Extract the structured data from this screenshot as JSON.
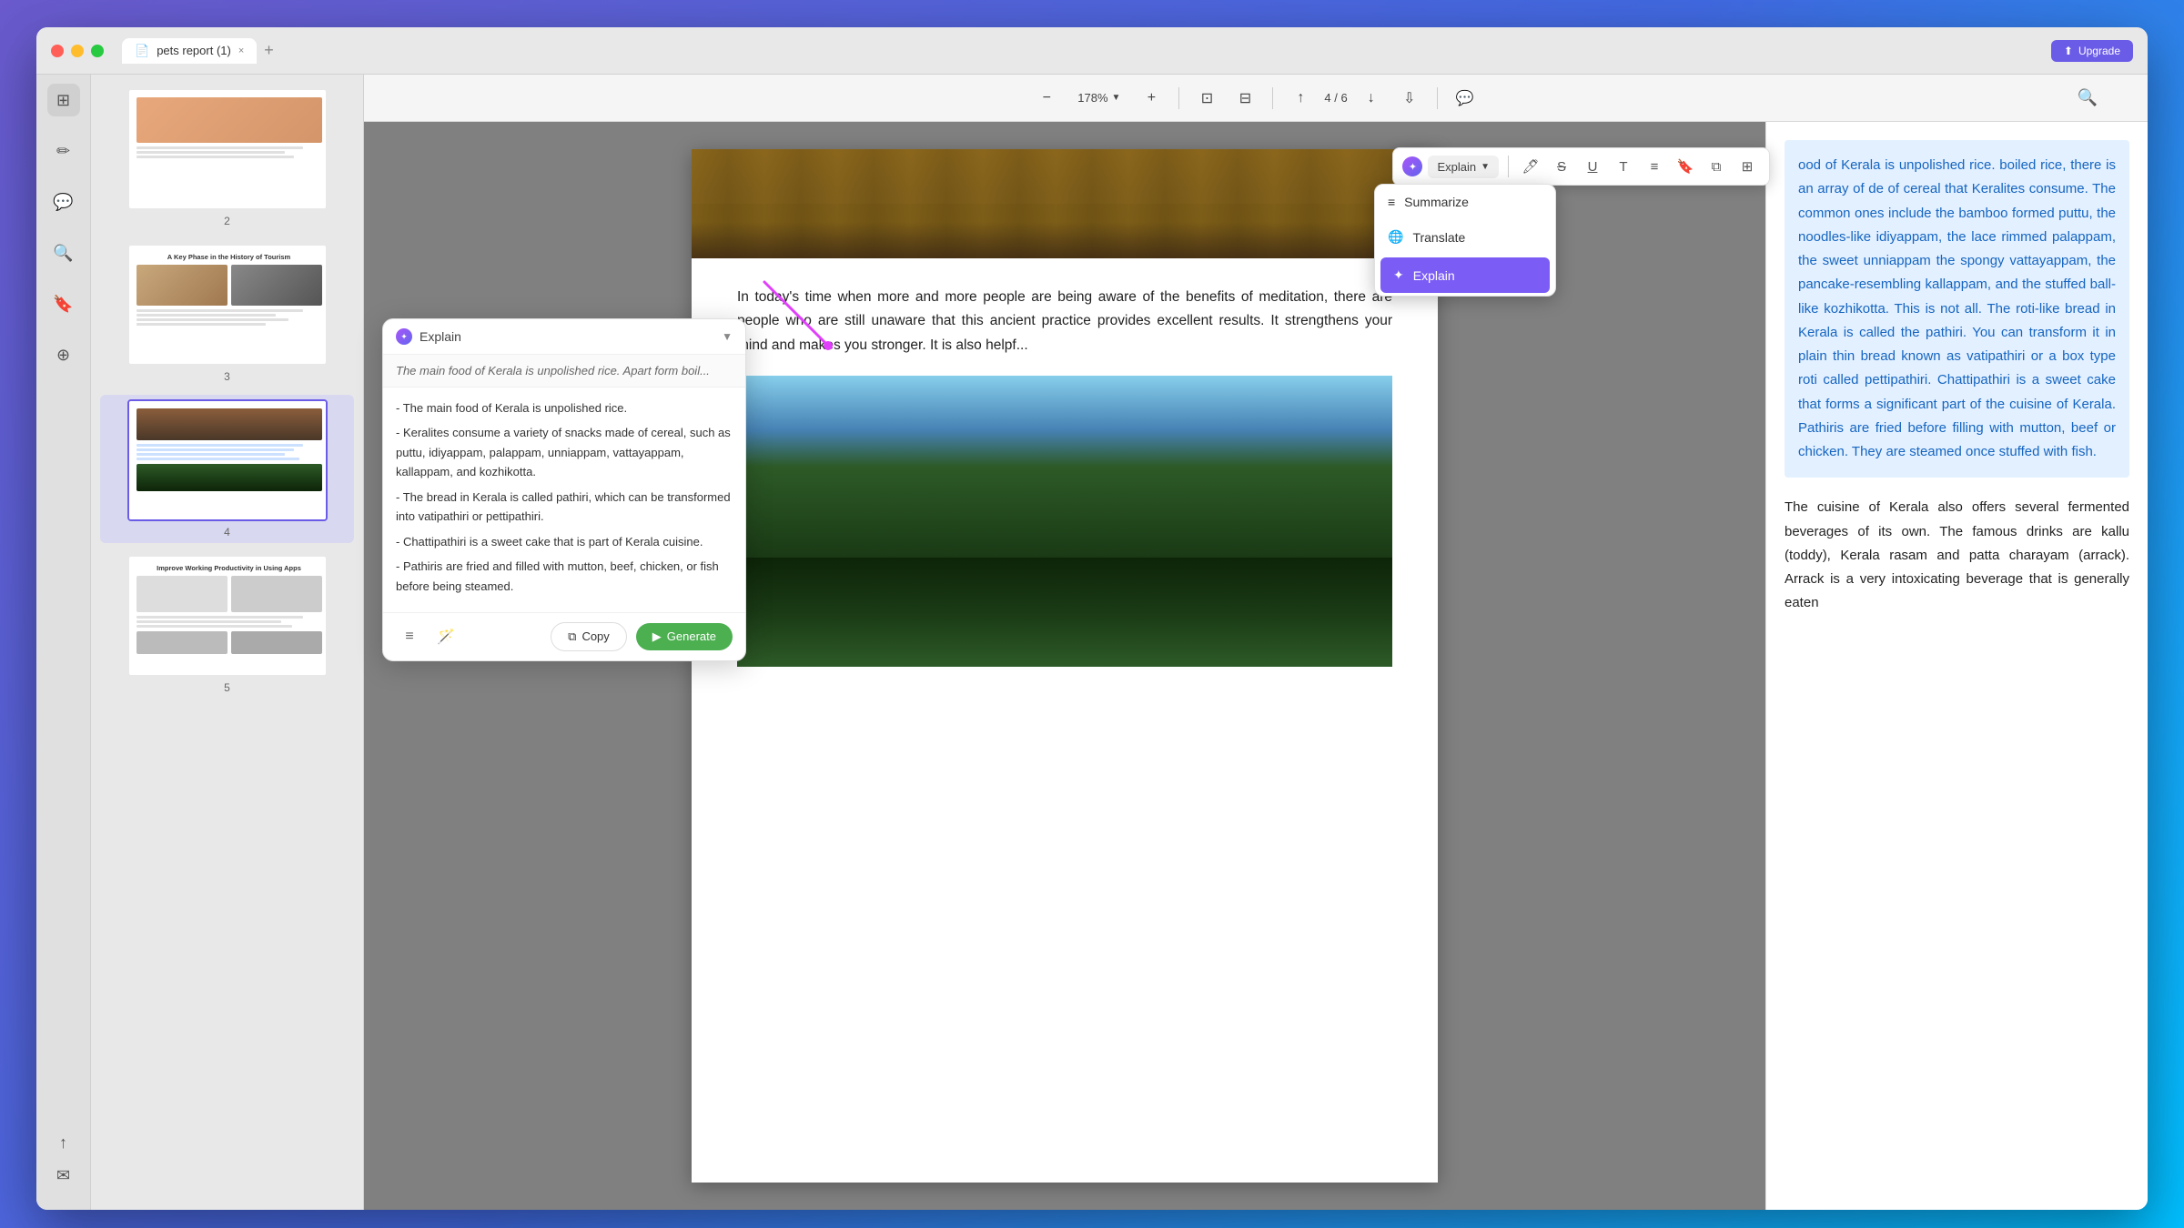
{
  "window": {
    "title": "pets report (1)",
    "tab_label": "pets report (1)",
    "upgrade_label": "Upgrade"
  },
  "toolbar": {
    "zoom_level": "178%",
    "page_current": "4",
    "page_total": "6"
  },
  "thumbnails": [
    {
      "number": "2",
      "title": "",
      "type": "tour",
      "active": false
    },
    {
      "number": "3",
      "title": "A Key Phase in the History of Tourism",
      "type": "nature",
      "active": false
    },
    {
      "number": "4",
      "title": "",
      "type": "city",
      "active": true
    },
    {
      "number": "5",
      "title": "Improve Working Productivity in Using Apps",
      "type": "office",
      "active": false
    }
  ],
  "annotation_toolbar": {
    "explain_label": "Explain",
    "icons": [
      "highlight",
      "strikethrough",
      "underline",
      "text",
      "comment",
      "bookmark",
      "copy-tool",
      "more"
    ]
  },
  "context_menu": {
    "items": [
      {
        "label": "Summarize",
        "icon": "≡"
      },
      {
        "label": "Translate",
        "icon": "🌐"
      },
      {
        "label": "Explain",
        "icon": "✦",
        "active": true
      }
    ]
  },
  "explain_popup": {
    "mode_label": "Explain",
    "input_text": "The main food of Kerala is unpolished rice. Apart form boil...",
    "result_lines": [
      "- The main food of Kerala is unpolished rice.",
      "- Keralites consume a variety of snacks made of cereal, such as puttu, idiyappam, palappam, unniappam, vattayappam, kallappam, and kozhikotta.",
      "- The bread in Kerala is called pathiri, which can be transformed into vatipathiri or pettipathiri.",
      "- Chattipathiri is a sweet cake that is part of Kerala cuisine.",
      "- Pathiris are fried and filled with mutton, beef, chicken, or fish before being steamed."
    ],
    "copy_label": "Copy",
    "generate_label": "Generate"
  },
  "pdf_content": {
    "paragraph1": "In today's time when more and more people are being aware of the benefits of meditation, there are people who are still unaware that this ancient practice provides excellent results. It strengthens your mind and makes you stronger. It is also helpf...",
    "highlighted_text": "ood of Kerala is unpolished rice. boiled rice, there is an array of de of cereal that Keralites consume. The common ones include the bamboo formed puttu, the noodles-like idiyappam, the lace rimmed palappam, the sweet unniappam the spongy vattayappam, the pancake-resembling kallappam, and the stuffed ball-like kozhikotta. This is not all. The roti-like bread in Kerala is called the pathiri. You can transform it in plain thin bread known as vatipathiri or a box type roti called pettipathiri. Chattipathiri is a sweet cake that forms a significant part of the cuisine of Kerala. Pathiris are fried before filling with mutton, beef or chicken. They are steamed once stuffed with fish.",
    "paragraph2": "The cuisine of Kerala also offers several fermented beverages of its own. The famous drinks are kallu (toddy), Kerala rasam and patta charayam (arrack). Arrack is a very intoxicating beverage that is generally eaten",
    "arrack_word": "Arrack"
  },
  "icons": {
    "close": "×",
    "plus": "+",
    "zoom_in": "+",
    "zoom_out": "−",
    "fit_page": "⊡",
    "arrow_up": "↑",
    "arrow_down": "↓",
    "first_page": "⇤",
    "last_page": "⇥",
    "comment": "💬",
    "search": "🔍",
    "pdf_icon": "📄",
    "copy_icon": "⧉",
    "generate_icon": "▶"
  }
}
